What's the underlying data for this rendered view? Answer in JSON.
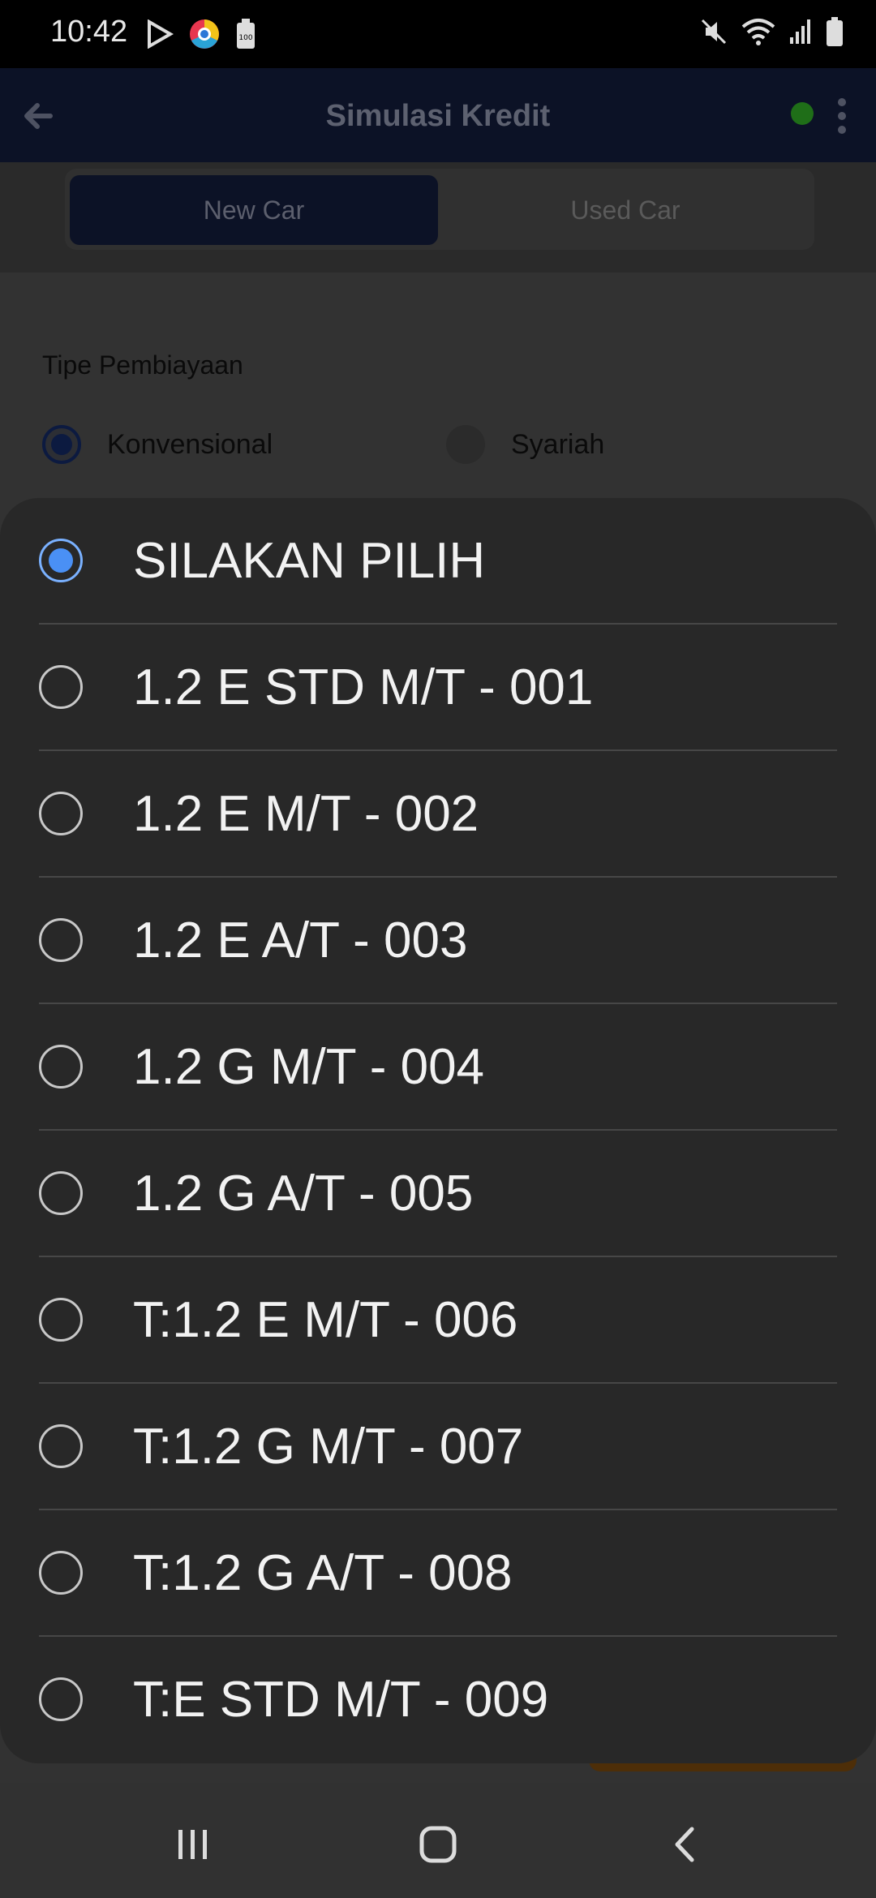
{
  "status_bar": {
    "time": "10:42",
    "icons_left": [
      "play-store-icon",
      "chrome-icon",
      "battery-saver-icon"
    ],
    "icons_right": [
      "mute-icon",
      "wifi-icon",
      "signal-icon",
      "battery-icon"
    ]
  },
  "app_bar": {
    "title": "Simulasi Kredit",
    "status_color": "#1f6e18"
  },
  "tabs": {
    "new_car": "New Car",
    "used_car": "Used Car",
    "active": "New Car"
  },
  "financing": {
    "label": "Tipe Pembiayaan",
    "options": [
      "Konvensional",
      "Syariah"
    ],
    "selected": "Konvensional"
  },
  "picker": {
    "selected": "SILAKAN PILIH",
    "options": [
      "SILAKAN PILIH",
      "1.2 E STD M/T - 001",
      "1.2 E M/T - 002",
      "1.2 E A/T - 003",
      "1.2 G M/T - 004",
      "1.2 G A/T - 005",
      "T:1.2 E M/T - 006",
      "T:1.2 G M/T - 007",
      "T:1.2 G A/T - 008",
      "T:E STD M/T - 009"
    ],
    "accent_color": "#4a90f5"
  },
  "nav_bar": {
    "buttons": [
      "recent-apps-icon",
      "home-icon",
      "back-icon"
    ]
  }
}
